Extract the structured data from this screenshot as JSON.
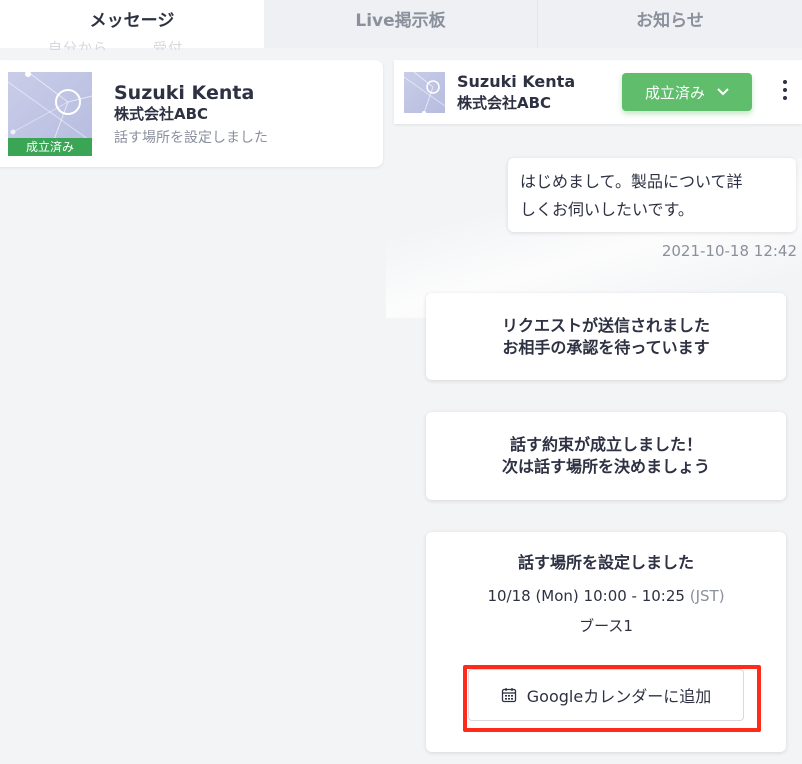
{
  "tabs": [
    {
      "label": "メッセージ",
      "active": true
    },
    {
      "label": "Live掲示板",
      "active": false
    },
    {
      "label": "お知らせ",
      "active": false
    }
  ],
  "left": {
    "ghost_text": "自分から　　　受付",
    "conversation": {
      "name": "Suzuki Kenta",
      "company": "株式会社ABC",
      "preview": "話す場所を設定しました",
      "status_tag": "成立済み"
    }
  },
  "chat": {
    "header": {
      "name": "Suzuki Kenta",
      "company": "株式会社ABC",
      "status_button": "成立済み"
    },
    "message": {
      "line1": "はじめまして。製品について詳",
      "line2": "しくお伺いしたいです。",
      "timestamp": "2021-10-18 12:42"
    },
    "system_1": {
      "line1": "リクエストが送信されました",
      "line2": "お相手の承認を待っています"
    },
    "system_2": {
      "line1": "話す約束が成立しました！",
      "line2": "次は話す場所を決めましょう"
    },
    "system_3": {
      "title": "話す場所を設定しました",
      "time": "10/18 (Mon) 10:00 - 10:25",
      "timezone": "(JST)",
      "place": "ブース1",
      "calendar_button": "Googleカレンダーに追加"
    }
  },
  "colors": {
    "accent_green": "#5fbd6c",
    "tag_green": "#3aa655",
    "highlight_red": "#ff2a1a"
  }
}
